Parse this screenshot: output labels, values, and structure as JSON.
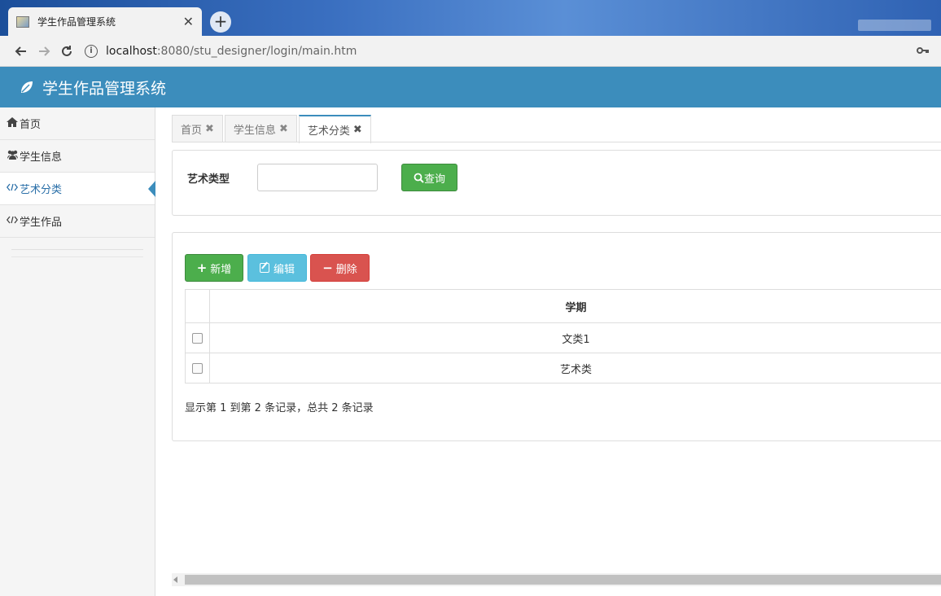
{
  "browser": {
    "tab_title": "学生作品管理系统",
    "close_glyph": "✕",
    "new_tab_glyph": "+",
    "url_host": "localhost",
    "url_rest": ":8080/stu_designer/login/main.htm"
  },
  "app": {
    "title": "学生作品管理系统"
  },
  "sidebar": {
    "items": [
      {
        "icon": "home-icon",
        "label": "首页"
      },
      {
        "icon": "users-icon",
        "label": "学生信息"
      },
      {
        "icon": "code-icon",
        "label": "艺术分类"
      },
      {
        "icon": "code-icon",
        "label": "学生作品"
      }
    ]
  },
  "page_tabs": [
    {
      "label": "首页"
    },
    {
      "label": "学生信息"
    },
    {
      "label": "艺术分类"
    }
  ],
  "search": {
    "label": "艺术类型",
    "value": "",
    "button": "查询"
  },
  "toolbar": {
    "add": "新增",
    "edit": "编辑",
    "delete": "删除"
  },
  "table": {
    "header": "学期",
    "rows": [
      "文类1",
      "艺术类"
    ]
  },
  "pager": {
    "info": "显示第 1 到第 2 条记录，总共 2 条记录"
  },
  "colors": {
    "header_bg": "#3c8dbc",
    "success": "#4cae4c",
    "info": "#5bc0de",
    "danger": "#d9534f"
  }
}
